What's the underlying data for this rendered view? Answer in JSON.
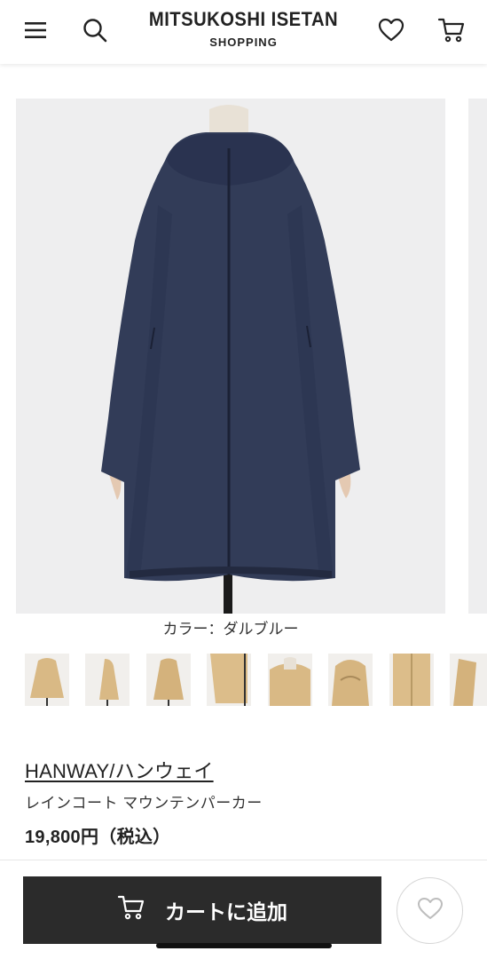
{
  "header": {
    "logo_main": "MITSUKOSHI ISETAN",
    "logo_sub": "SHOPPING",
    "icons": [
      "menu-icon",
      "search-icon",
      "heart-icon",
      "cart-icon"
    ]
  },
  "product": {
    "color_label": "カラー：ダルブルー",
    "thumbnail_count": 8,
    "brand": "HANWAY/ハンウェイ",
    "name": "レインコート マウンテンパーカー",
    "price": "19,800円（税込）"
  },
  "actions": {
    "add_to_cart_label": "カートに追加"
  },
  "colors": {
    "coat_navy": "#2f3952",
    "thumb_tan": "#d9b985",
    "button_dark": "#2b2b2b"
  }
}
